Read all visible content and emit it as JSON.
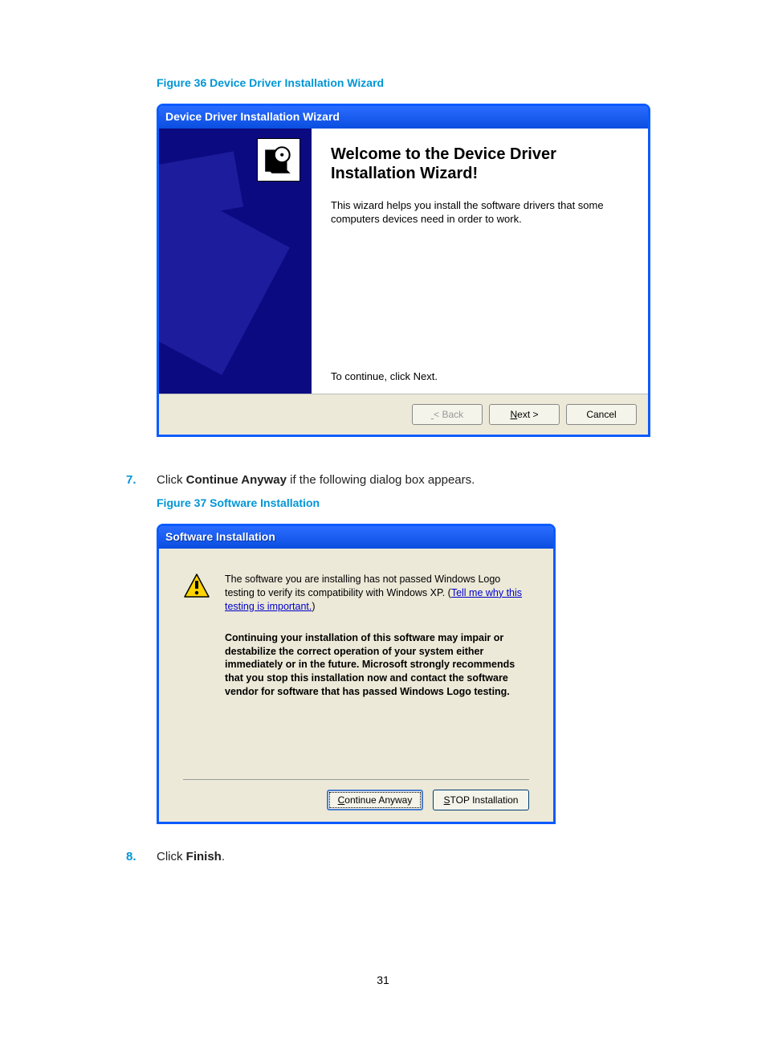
{
  "figure36": {
    "caption": "Figure 36 Device Driver Installation Wizard",
    "title": "Device Driver Installation Wizard",
    "heading": "Welcome to the Device Driver Installation Wizard!",
    "description": "This wizard helps you install the software drivers that some computers devices need in order to work.",
    "continueHint": "To continue, click Next.",
    "buttons": {
      "back": "< Back",
      "next": "Next >",
      "cancel": "Cancel"
    }
  },
  "step7": {
    "num": "7.",
    "prefix": "Click ",
    "bold": "Continue Anyway",
    "suffix": " if the following dialog box appears."
  },
  "figure37": {
    "caption": "Figure 37 Software Installation",
    "title": "Software Installation",
    "msgPart1": "The software you are installing has not passed Windows Logo testing to verify its compatibility with Windows XP. (",
    "link": "Tell me why this testing is important.",
    "msgPart1b": ")",
    "msgBold": "Continuing your installation of this software may impair or destabilize the correct operation of your system either immediately or in the future. Microsoft strongly recommends that you stop this installation now and contact the software vendor for software that has passed Windows Logo testing.",
    "buttons": {
      "continue": "Continue Anyway",
      "stop": "STOP Installation"
    }
  },
  "step8": {
    "num": "8.",
    "prefix": "Click ",
    "bold": "Finish",
    "suffix": "."
  },
  "pageNumber": "31"
}
